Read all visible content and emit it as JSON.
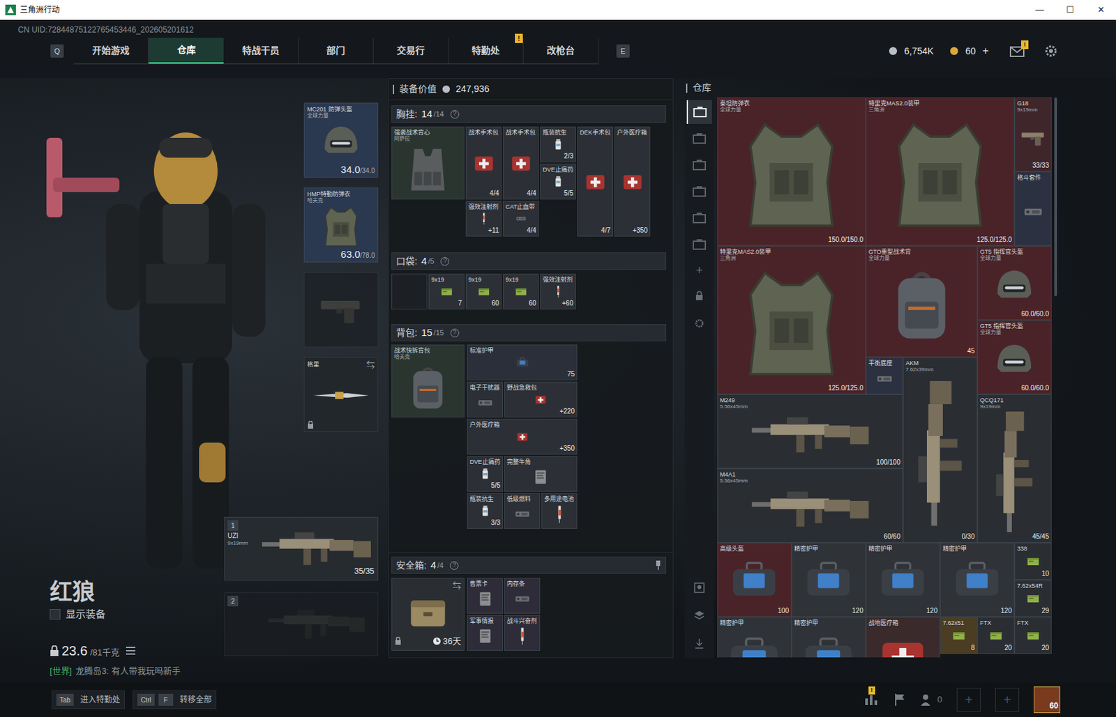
{
  "window": {
    "title": "三角洲行动",
    "controls": [
      "—",
      "☐",
      "✕"
    ]
  },
  "uid": "CN UID:72844875122765453446_202605201612",
  "nav": {
    "prev_key": "Q",
    "next_key": "E",
    "alert_glyph": "!",
    "tabs": [
      {
        "label": "开始游戏",
        "selected": false,
        "alert": false
      },
      {
        "label": "仓库",
        "selected": true,
        "alert": false
      },
      {
        "label": "特战干员",
        "selected": false,
        "alert": false
      },
      {
        "label": "部门",
        "selected": false,
        "alert": false
      },
      {
        "label": "交易行",
        "selected": false,
        "alert": false
      },
      {
        "label": "特勤处",
        "selected": false,
        "alert": true
      },
      {
        "label": "改枪台",
        "selected": false,
        "alert": false
      }
    ]
  },
  "wallet": {
    "silver": "6,754K",
    "gold": "60",
    "add": "+",
    "mail_alert": "!"
  },
  "character": {
    "name": "红狼",
    "show_equipment": {
      "label": "显示装备",
      "checked": false
    },
    "weight": "23.6",
    "capacity": "/81千克"
  },
  "chat": {
    "channel": "[世界]",
    "text": "龙腾岛3: 有人带我玩吗新手"
  },
  "helmet": {
    "name": "MC201 防弹头盔",
    "sub": "全球力量",
    "value": "34.0",
    "max": "/34.0",
    "kind": "helmet",
    "color": "#2a3850"
  },
  "armor": {
    "name": "HMP特勤防弹衣",
    "sub": "哈夫克",
    "value": "63.0",
    "max": "/78.0",
    "kind": "vest",
    "color": "#2a3850"
  },
  "pistol_slot": {
    "empty": true
  },
  "melee": {
    "name": "格里",
    "swap": "⇆",
    "locked": true
  },
  "weapons": [
    {
      "index": "1",
      "name": "UZI",
      "caliber": "9x19mm",
      "ammo": "35/35",
      "empty": false
    },
    {
      "index": "2",
      "empty": true
    }
  ],
  "loadout": {
    "value_label": "装备价值",
    "value": "247,936",
    "rig": {
      "label": "胸挂:",
      "count": "14",
      "max": "/14",
      "help": "?",
      "container": {
        "name": "强袭战术背心",
        "sub": "阿萨拉",
        "kind": "rig",
        "color": "#2a3530"
      },
      "items": [
        {
          "name": "战术手术包",
          "value": "4/4",
          "kind": "medkit",
          "color": "#2c3036"
        },
        {
          "name": "战术手术包",
          "value": "4/4",
          "kind": "medkit",
          "color": "#2c3036"
        },
        {
          "name": "瓶装抗生",
          "value": "2/3",
          "kind": "pills",
          "color": "#2c3036"
        },
        {
          "name": "DVE止痛药",
          "value": "5/5",
          "kind": "pills",
          "color": "#2c3036"
        },
        {
          "name": "DEK手术包",
          "value": "4/7",
          "kind": "medkit",
          "color": "#2c3036"
        },
        {
          "name": "户外医疗箱",
          "value": "+350",
          "kind": "medkit",
          "color": "#2c3036"
        },
        {
          "name": "强效注射剂",
          "value": "+11",
          "kind": "syringe",
          "color": "#2c3036"
        },
        {
          "name": "CAT止血带",
          "value": "4/4",
          "kind": "tool",
          "color": "#2c3036"
        }
      ]
    },
    "pockets": {
      "label": "口袋:",
      "count": "4",
      "max": "/5",
      "help": "?",
      "items": [
        {
          "kind": "empty",
          "color": "#1c2025"
        },
        {
          "name": "9x19",
          "value": "7",
          "kind": "ammo",
          "color": "#2c3036"
        },
        {
          "name": "9x19",
          "value": "60",
          "kind": "ammo",
          "color": "#2c3036"
        },
        {
          "name": "9x19",
          "value": "60",
          "kind": "ammo",
          "color": "#2c3036"
        },
        {
          "name": "强效注射剂",
          "value": "+60",
          "kind": "syringe",
          "color": "#2c3036"
        }
      ]
    },
    "backpack": {
      "label": "背包:",
      "count": "15",
      "max": "/15",
      "help": "?",
      "container": {
        "name": "战术快拆背包",
        "sub": "哈夫克",
        "kind": "backpack",
        "color": "#2a3530"
      },
      "items": [
        {
          "name": "标准护甲",
          "value": "75",
          "kind": "bag",
          "color": "#2a2f3a"
        },
        {
          "name": "电子干扰器",
          "kind": "tool",
          "color": "#2c3036"
        },
        {
          "name": "野战急救包",
          "value": "+220",
          "kind": "medkit",
          "color": "#2c3036"
        },
        {
          "name": "户外医疗箱",
          "value": "+350",
          "kind": "medkit",
          "color": "#2c3036"
        },
        {
          "name": "DVE止痛药",
          "value": "5/5",
          "kind": "pills",
          "color": "#2c3036"
        },
        {
          "name": "完整牛角",
          "kind": "misc",
          "color": "#2c3036"
        },
        {
          "name": "瓶装抗生",
          "value": "3/3",
          "kind": "pills",
          "color": "#2c3036"
        },
        {
          "name": "低级燃料",
          "kind": "tool",
          "color": "#2c3036"
        },
        {
          "name": "多用途电池",
          "kind": "syringe",
          "color": "#2c3036"
        }
      ]
    },
    "safe": {
      "label": "安全箱:",
      "count": "4",
      "max": "/4",
      "help": "?",
      "days": "36天",
      "swap": "⇆",
      "locked": true,
      "items": [
        {
          "name": "售票卡",
          "kind": "misc",
          "color": "#2e2c38"
        },
        {
          "name": "内存条",
          "kind": "tool",
          "color": "#2e2c38"
        },
        {
          "name": "军事情报",
          "kind": "misc",
          "color": "#2e2c38"
        },
        {
          "name": "战斗兴奋剂",
          "kind": "syringe",
          "color": "#2e2c38"
        }
      ]
    }
  },
  "stash": {
    "title": "仓库",
    "add": "+",
    "side_tabs": [
      {
        "selected": true
      },
      {
        "selected": false
      },
      {
        "selected": false
      },
      {
        "selected": false
      },
      {
        "selected": false
      },
      {
        "selected": false
      }
    ],
    "items": [
      {
        "name": "秦坦防弹衣",
        "sub": "全球力量",
        "value": "150.0/150.0",
        "kind": "vest",
        "color": "#4a2328"
      },
      {
        "name": "特里克MAS2.0装甲",
        "sub": "三角洲",
        "value": "125.0/125.0",
        "kind": "vest",
        "color": "#4a2328"
      },
      {
        "name": "G18",
        "sub": "9x19mm",
        "value": "33/33",
        "kind": "pistol",
        "color": "#3e262b"
      },
      {
        "name": "格斗套件",
        "kind": "tool",
        "color": "#2b3140"
      },
      {
        "name": "特里克MAS2.0装甲",
        "sub": "三角洲",
        "value": "125.0/125.0",
        "kind": "vest",
        "color": "#4a2328"
      },
      {
        "name": "GTO重型战术背",
        "sub": "全球力量",
        "value": "45",
        "kind": "backpack",
        "color": "#4a2328"
      },
      {
        "name": "GT5 指挥官头盔",
        "sub": "全球力量",
        "value": "60.0/60.0",
        "kind": "helmet",
        "color": "#4a2328"
      },
      {
        "name": "GT5 指挥官头盔",
        "sub": "全球力量",
        "value": "60.0/60.0",
        "kind": "helmet",
        "color": "#4a2328"
      },
      {
        "name": "平衡底座",
        "kind": "tool",
        "color": "#2b3140"
      },
      {
        "name": "AKM",
        "sub": "7.62x39mm",
        "value": "0/30",
        "kind": "rifle",
        "color": "#2a2e33"
      },
      {
        "name": "M249",
        "sub": "5.56x45mm",
        "value": "100/100",
        "kind": "rifle",
        "color": "#2a2e33"
      },
      {
        "name": "M4A1",
        "sub": "5.56x45mm",
        "value": "60/60",
        "kind": "rifle",
        "color": "#2a2e33"
      },
      {
        "name": "QCQ171",
        "sub": "9x19mm",
        "value": "45/45",
        "kind": "rifle",
        "color": "#2a2e33"
      },
      {
        "name": "高级头盔",
        "value": "100",
        "kind": "bag",
        "color": "#4a2328"
      },
      {
        "name": "精密护甲",
        "value": "120",
        "kind": "bag",
        "color": "#2f3236"
      },
      {
        "name": "精密护甲",
        "value": "120",
        "kind": "bag",
        "color": "#2f3236"
      },
      {
        "name": "精密护甲",
        "value": "120",
        "kind": "bag",
        "color": "#2f3236"
      },
      {
        "name": "338",
        "value": "10",
        "kind": "ammo",
        "color": "#2a2e33"
      },
      {
        "name": "7.62x54R",
        "value": "29",
        "kind": "ammo",
        "color": "#2a2e33"
      },
      {
        "name": "精密护甲",
        "kind": "bag",
        "color": "#2f3236"
      },
      {
        "name": "精密护甲",
        "kind": "bag",
        "color": "#2f3236"
      },
      {
        "name": "战地医疗箱",
        "kind": "medkit",
        "color": "#3a2a2c"
      },
      {
        "name": "7.62x51",
        "value": "8",
        "kind": "ammo",
        "color": "#4a3d22"
      },
      {
        "name": "FTX",
        "value": "20",
        "kind": "ammo",
        "color": "#2a2e33"
      },
      {
        "name": "FTX",
        "value": "20",
        "kind": "ammo",
        "color": "#2a2e33"
      }
    ]
  },
  "bottom_bar": {
    "hints": [
      {
        "keys": [
          "Tab"
        ],
        "label": "进入特勤处"
      },
      {
        "keys": [
          "Ctrl",
          "F"
        ],
        "label": "转移全部"
      }
    ],
    "stats_alert": "!",
    "friends": "0",
    "add_slots": [
      "+",
      "+"
    ],
    "level": "60"
  }
}
